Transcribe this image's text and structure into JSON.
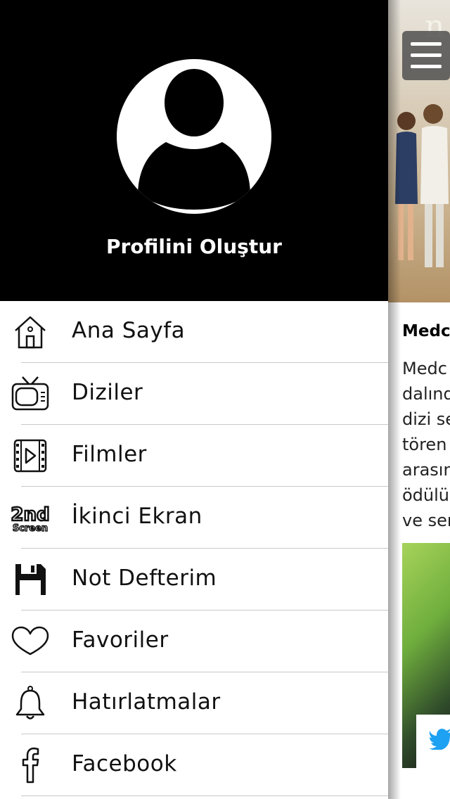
{
  "profile": {
    "name_label": "Profilini Oluştur"
  },
  "menu": {
    "items": [
      {
        "label": "Ana Sayfa",
        "icon": "home-icon"
      },
      {
        "label": "Diziler",
        "icon": "tv-icon"
      },
      {
        "label": "Filmler",
        "icon": "film-icon"
      },
      {
        "label": "İkinci Ekran",
        "icon": "second-screen-icon"
      },
      {
        "label": "Not Defterim",
        "icon": "floppy-disk-icon"
      },
      {
        "label": "Favoriler",
        "icon": "heart-icon"
      },
      {
        "label": "Hatırlatmalar",
        "icon": "bell-icon"
      },
      {
        "label": "Facebook",
        "icon": "facebook-icon"
      }
    ]
  },
  "content": {
    "hero_logo": "n",
    "article_title": "Medc",
    "article_lines": [
      "Medc",
      "dalınd",
      "dizi se",
      "tören",
      "arasın",
      "ödülü",
      "ve ser"
    ]
  },
  "second_screen_badge": {
    "big": "2nd",
    "small": "Screen"
  },
  "colors": {
    "drawer_header": "#000000",
    "menu_background": "#ffffff",
    "separator": "#c9c9c9",
    "twitter": "#1da1f2"
  }
}
